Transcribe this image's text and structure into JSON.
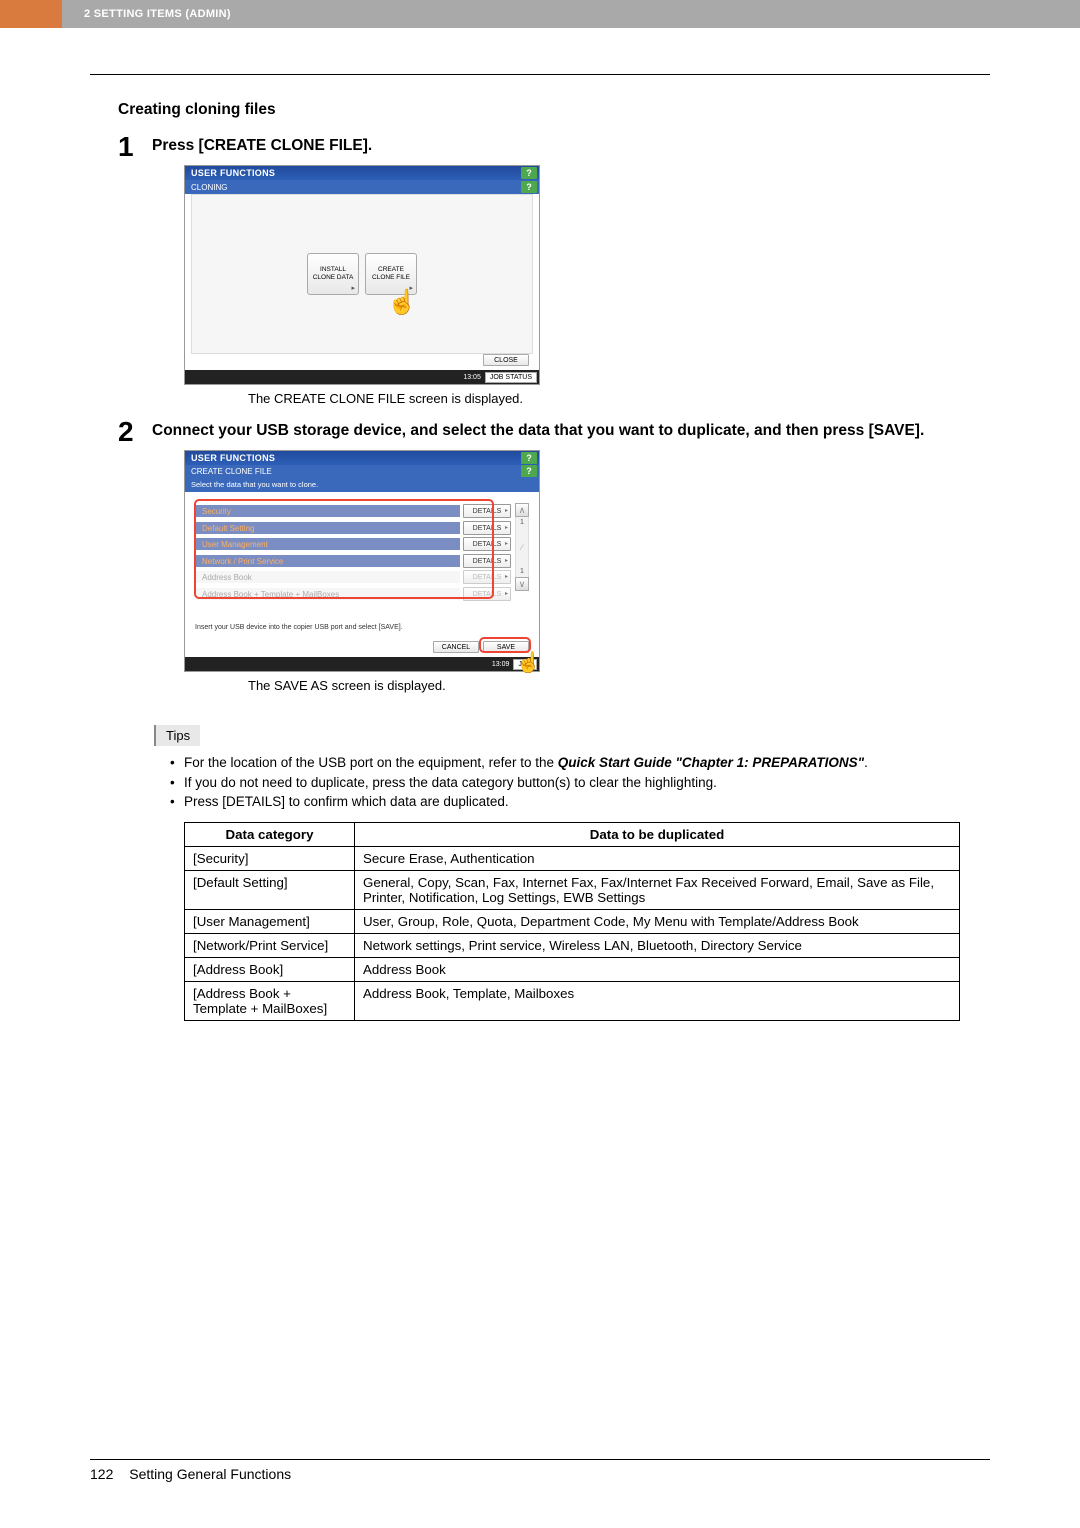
{
  "header": {
    "breadcrumb": "2 SETTING ITEMS (ADMIN)"
  },
  "section_title": "Creating cloning files",
  "steps": {
    "s1": {
      "num": "1",
      "text": "Press [CREATE CLONE FILE]."
    },
    "s2": {
      "num": "2",
      "text": "Connect your USB storage device, and select the data that you want to duplicate, and then press [SAVE]."
    }
  },
  "ss1": {
    "title": "USER FUNCTIONS",
    "sub": "CLONING",
    "help": "?",
    "btn_install_l1": "INSTALL",
    "btn_install_l2": "CLONE DATA",
    "btn_create_l1": "CREATE",
    "btn_create_l2": "CLONE FILE",
    "close": "CLOSE",
    "time": "13:05",
    "jobstatus": "JOB STATUS"
  },
  "caption1": "The CREATE CLONE FILE screen is displayed.",
  "ss2": {
    "title": "USER FUNCTIONS",
    "sub": "CREATE CLONE FILE",
    "instr": "Select the data that you want to clone.",
    "rows": [
      {
        "label": "Security",
        "details": "DETAILS",
        "orange": true
      },
      {
        "label": "Default Setting",
        "details": "DETAILS",
        "orange": true
      },
      {
        "label": "User Management",
        "details": "DETAILS",
        "orange": true
      },
      {
        "label": "Network / Print Service",
        "details": "DETAILS",
        "orange": true
      },
      {
        "label": "Address Book",
        "details": "DETAILS",
        "dim": true
      },
      {
        "label": "Address Book + Template + MailBoxes",
        "details": "DETAILS",
        "dim": true
      }
    ],
    "footer_text": "Insert your USB device into the copier USB port and select [SAVE].",
    "cancel": "CANCEL",
    "save": "SAVE",
    "time": "13:09",
    "jobstatus": "JOB",
    "page_indicator_top": "1",
    "page_indicator_bot": "1"
  },
  "caption2": "The SAVE AS screen is displayed.",
  "tips_label": "Tips",
  "tips": {
    "t1a": "For the location of the USB port on the equipment, refer to the ",
    "t1b": "Quick Start Guide \"Chapter 1: PREPARATIONS\"",
    "t1c": ".",
    "t2": "If you do not need to duplicate, press the data category button(s) to clear the highlighting.",
    "t3": "Press [DETAILS] to confirm which data are duplicated."
  },
  "table": {
    "h1": "Data category",
    "h2": "Data to be duplicated",
    "rows": [
      {
        "c": "[Security]",
        "d": "Secure Erase, Authentication"
      },
      {
        "c": "[Default Setting]",
        "d": "General, Copy, Scan, Fax, Internet Fax, Fax/Internet Fax Received Forward, Email, Save as File, Printer, Notification, Log Settings, EWB Settings"
      },
      {
        "c": "[User Management]",
        "d": "User, Group, Role, Quota, Department Code, My Menu with Template/Address Book"
      },
      {
        "c": "[Network/Print Service]",
        "d": "Network settings, Print service, Wireless LAN, Bluetooth, Directory Service"
      },
      {
        "c": "[Address Book]",
        "d": "Address Book"
      },
      {
        "c": "[Address Book + Template + MailBoxes]",
        "d": "Address Book, Template, Mailboxes"
      }
    ]
  },
  "footer": {
    "page": "122",
    "title": "Setting General Functions"
  }
}
